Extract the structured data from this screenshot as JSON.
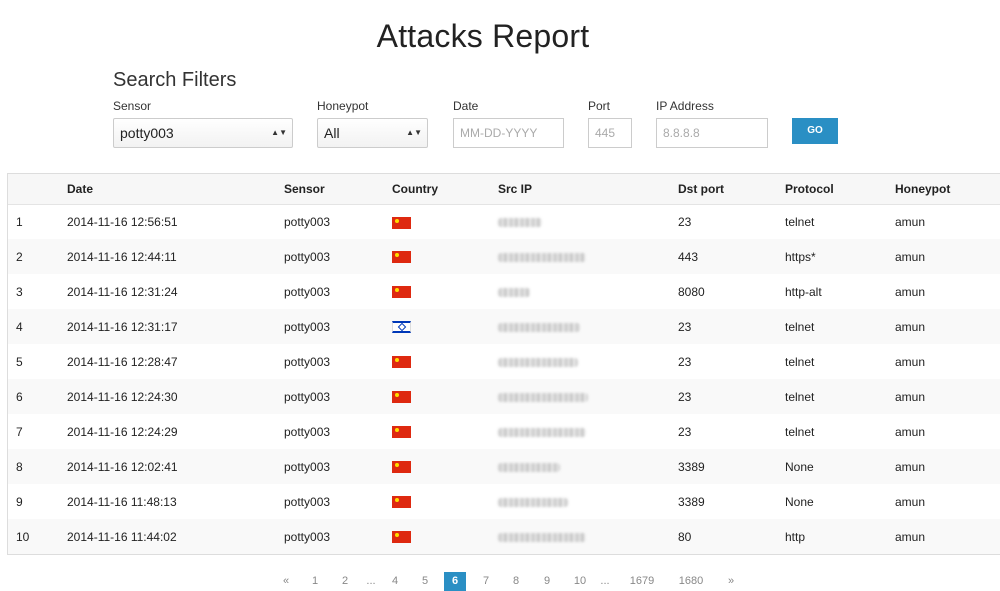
{
  "page_title": "Attacks Report",
  "filters": {
    "title": "Search Filters",
    "sensor": {
      "label": "Sensor",
      "value": "potty003"
    },
    "honeypot": {
      "label": "Honeypot",
      "value": "All"
    },
    "date": {
      "label": "Date",
      "placeholder": "MM-DD-YYYY"
    },
    "port": {
      "label": "Port",
      "placeholder": "445"
    },
    "ip": {
      "label": "IP Address",
      "placeholder": "8.8.8.8"
    },
    "go_label": "GO"
  },
  "table": {
    "headers": [
      "",
      "Date",
      "Sensor",
      "Country",
      "Src IP",
      "Dst port",
      "Protocol",
      "Honeypot"
    ],
    "rows": [
      {
        "num": "1",
        "date": "2014-11-16 12:56:51",
        "sensor": "potty003",
        "country": "cn-flag-icon",
        "dst_port": "23",
        "protocol": "telnet",
        "honeypot": "amun"
      },
      {
        "num": "2",
        "date": "2014-11-16 12:44:11",
        "sensor": "potty003",
        "country": "cn-flag-icon",
        "dst_port": "443",
        "protocol": "https*",
        "honeypot": "amun"
      },
      {
        "num": "3",
        "date": "2014-11-16 12:31:24",
        "sensor": "potty003",
        "country": "cn-flag-icon",
        "dst_port": "8080",
        "protocol": "http-alt",
        "honeypot": "amun"
      },
      {
        "num": "4",
        "date": "2014-11-16 12:31:17",
        "sensor": "potty003",
        "country": "il-flag-icon",
        "dst_port": "23",
        "protocol": "telnet",
        "honeypot": "amun"
      },
      {
        "num": "5",
        "date": "2014-11-16 12:28:47",
        "sensor": "potty003",
        "country": "cn-flag-icon",
        "dst_port": "23",
        "protocol": "telnet",
        "honeypot": "amun"
      },
      {
        "num": "6",
        "date": "2014-11-16 12:24:30",
        "sensor": "potty003",
        "country": "cn-flag-icon",
        "dst_port": "23",
        "protocol": "telnet",
        "honeypot": "amun"
      },
      {
        "num": "7",
        "date": "2014-11-16 12:24:29",
        "sensor": "potty003",
        "country": "cn-flag-icon",
        "dst_port": "23",
        "protocol": "telnet",
        "honeypot": "amun"
      },
      {
        "num": "8",
        "date": "2014-11-16 12:02:41",
        "sensor": "potty003",
        "country": "cn-flag-icon",
        "dst_port": "3389",
        "protocol": "None",
        "honeypot": "amun"
      },
      {
        "num": "9",
        "date": "2014-11-16 11:48:13",
        "sensor": "potty003",
        "country": "cn-flag-icon",
        "dst_port": "3389",
        "protocol": "None",
        "honeypot": "amun"
      },
      {
        "num": "10",
        "date": "2014-11-16 11:44:02",
        "sensor": "potty003",
        "country": "cn-flag-icon",
        "dst_port": "80",
        "protocol": "http",
        "honeypot": "amun"
      }
    ]
  },
  "pagination": {
    "prev": "«",
    "next": "»",
    "ellipsis": "...",
    "pages": [
      "1",
      "2",
      "4",
      "5",
      "6",
      "7",
      "8",
      "9",
      "10",
      "1679",
      "1680"
    ],
    "active": "6"
  },
  "colors": {
    "accent": "#2a8fc4"
  }
}
